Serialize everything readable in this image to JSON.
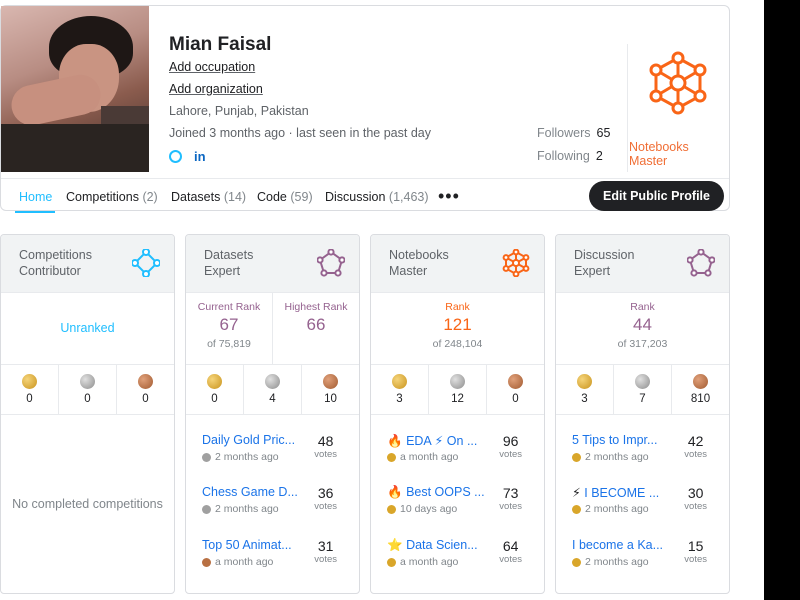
{
  "profile": {
    "name": "Mian Faisal",
    "add_occupation": "Add occupation",
    "add_organization": "Add organization",
    "location": "Lahore, Punjab, Pakistan",
    "joined": "Joined 3 months ago · last seen in the past day",
    "followers_label": "Followers",
    "followers_value": "65",
    "following_label": "Following",
    "following_value": "2",
    "highlight_tier": "Notebooks Master",
    "edit_button": "Edit Public Profile"
  },
  "tabs": [
    {
      "label": "Home",
      "count": ""
    },
    {
      "label": "Competitions",
      "count": "(2)"
    },
    {
      "label": "Datasets",
      "count": "(14)"
    },
    {
      "label": "Code",
      "count": "(59)"
    },
    {
      "label": "Discussion",
      "count": "(1,463)"
    }
  ],
  "more_label": "•••",
  "colors": {
    "accent": "#20beff",
    "competitions": "#20beff",
    "expert": "#95628f",
    "master": "#f96517",
    "gold": "#d9a62a",
    "silver": "#a0a0a0",
    "bronze": "#b87043"
  },
  "cards": [
    {
      "tier_line1": "Competitions",
      "tier_line2": "Contributor",
      "icon": "competitions-contributor-icon",
      "unranked": "Unranked",
      "medals": {
        "gold": "0",
        "silver": "0",
        "bronze": "0"
      },
      "empty_text": "No completed competitions"
    },
    {
      "tier_line1": "Datasets",
      "tier_line2": "Expert",
      "icon": "datasets-expert-icon",
      "current_rank_label": "Current Rank",
      "current_rank": "67",
      "current_rank_of": "of 75,819",
      "highest_rank_label": "Highest Rank",
      "highest_rank": "66",
      "medals": {
        "gold": "0",
        "silver": "4",
        "bronze": "10"
      },
      "items": [
        {
          "prefix": "",
          "title": "Daily Gold Pric...",
          "medal": "silver",
          "time": "2 months ago",
          "votes": "48",
          "votes_label": "votes"
        },
        {
          "prefix": "",
          "title": "Chess Game D...",
          "medal": "silver",
          "time": "2 months ago",
          "votes": "36",
          "votes_label": "votes"
        },
        {
          "prefix": "",
          "title": "Top 50 Animat...",
          "medal": "bronze",
          "time": "a month ago",
          "votes": "31",
          "votes_label": "votes"
        }
      ]
    },
    {
      "tier_line1": "Notebooks",
      "tier_line2": "Master",
      "icon": "notebooks-master-icon",
      "rank_label": "Rank",
      "rank": "121",
      "rank_of": "of 248,104",
      "medals": {
        "gold": "3",
        "silver": "12",
        "bronze": "0"
      },
      "items": [
        {
          "prefix": "🔥",
          "title": "EDA ⚡ On ...",
          "medal": "gold",
          "time": "a month ago",
          "votes": "96",
          "votes_label": "votes"
        },
        {
          "prefix": "🔥",
          "title": "Best OOPS ...",
          "medal": "gold",
          "time": "10 days ago",
          "votes": "73",
          "votes_label": "votes"
        },
        {
          "prefix": "⭐",
          "title": "Data Scien...",
          "medal": "gold",
          "time": "a month ago",
          "votes": "64",
          "votes_label": "votes"
        }
      ]
    },
    {
      "tier_line1": "Discussion",
      "tier_line2": "Expert",
      "icon": "discussion-expert-icon",
      "rank_label": "Rank",
      "rank": "44",
      "rank_of": "of 317,203",
      "medals": {
        "gold": "3",
        "silver": "7",
        "bronze": "810"
      },
      "items": [
        {
          "prefix": "",
          "title": "5 Tips to Impr...",
          "medal": "gold",
          "time": "2 months ago",
          "votes": "42",
          "votes_label": "votes"
        },
        {
          "prefix": "⚡",
          "title": "I BECOME ...",
          "medal": "gold",
          "time": "2 months ago",
          "votes": "30",
          "votes_label": "votes"
        },
        {
          "prefix": "",
          "title": "I become a Ka...",
          "medal": "gold",
          "time": "2 months ago",
          "votes": "15",
          "votes_label": "votes"
        }
      ]
    }
  ]
}
